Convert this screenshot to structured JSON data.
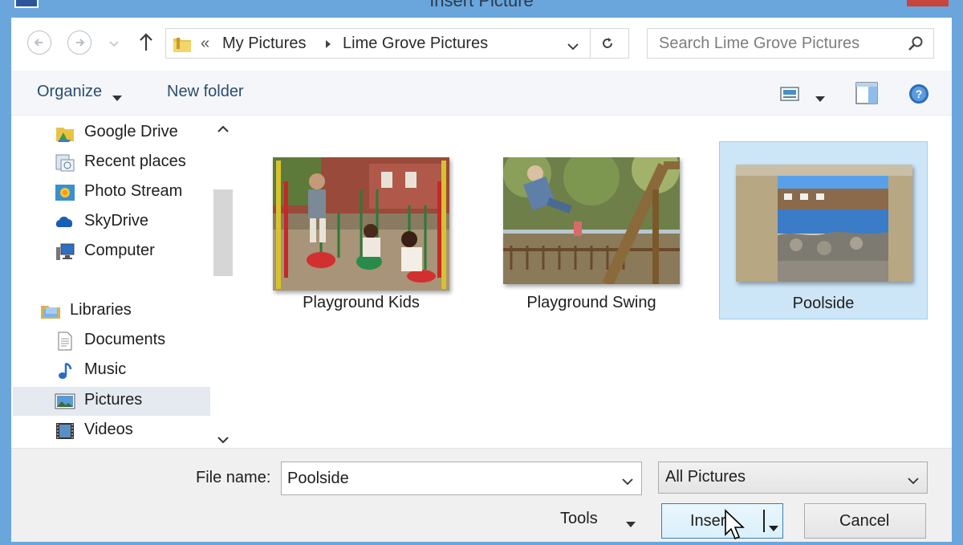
{
  "window": {
    "title": "Insert Picture",
    "accent_color": "#6aa6dc"
  },
  "nav": {
    "back_icon": "back-arrow-icon",
    "forward_icon": "forward-arrow-icon",
    "up_icon": "up-arrow-icon",
    "recent_icon": "chevron-down-icon"
  },
  "address": {
    "overflow": "«",
    "crumbs": [
      "My Pictures",
      "Lime Grove Pictures"
    ],
    "folder_icon": "folder-icon",
    "refresh_icon": "refresh-icon"
  },
  "search": {
    "placeholder": "Search Lime Grove Pictures",
    "icon": "search-icon"
  },
  "toolbar": {
    "organize_label": "Organize",
    "new_folder_label": "New folder",
    "view_icon": "view-options-icon",
    "preview_pane_icon": "preview-pane-icon",
    "help_icon": "help-icon"
  },
  "sidebar": {
    "items": [
      {
        "label": "Google Drive",
        "icon": "google-drive-icon"
      },
      {
        "label": "Recent places",
        "icon": "recent-places-icon"
      },
      {
        "label": "Photo Stream",
        "icon": "photo-stream-icon"
      },
      {
        "label": "SkyDrive",
        "icon": "skydrive-icon"
      },
      {
        "label": "Computer",
        "icon": "computer-icon"
      },
      {
        "label": "Libraries",
        "icon": "libraries-icon"
      },
      {
        "label": "Documents",
        "icon": "documents-icon"
      },
      {
        "label": "Music",
        "icon": "music-icon"
      },
      {
        "label": "Pictures",
        "icon": "pictures-icon",
        "selected": true
      },
      {
        "label": "Videos",
        "icon": "videos-icon"
      }
    ]
  },
  "files": [
    {
      "name": "Playground Kids",
      "selected": false
    },
    {
      "name": "Playground Swing",
      "selected": false
    },
    {
      "name": "Poolside",
      "selected": true
    }
  ],
  "footer": {
    "file_name_label": "File name:",
    "file_name_value": "Poolside",
    "filter_value": "All Pictures",
    "tools_label": "Tools",
    "insert_label": "Insert",
    "cancel_label": "Cancel"
  }
}
